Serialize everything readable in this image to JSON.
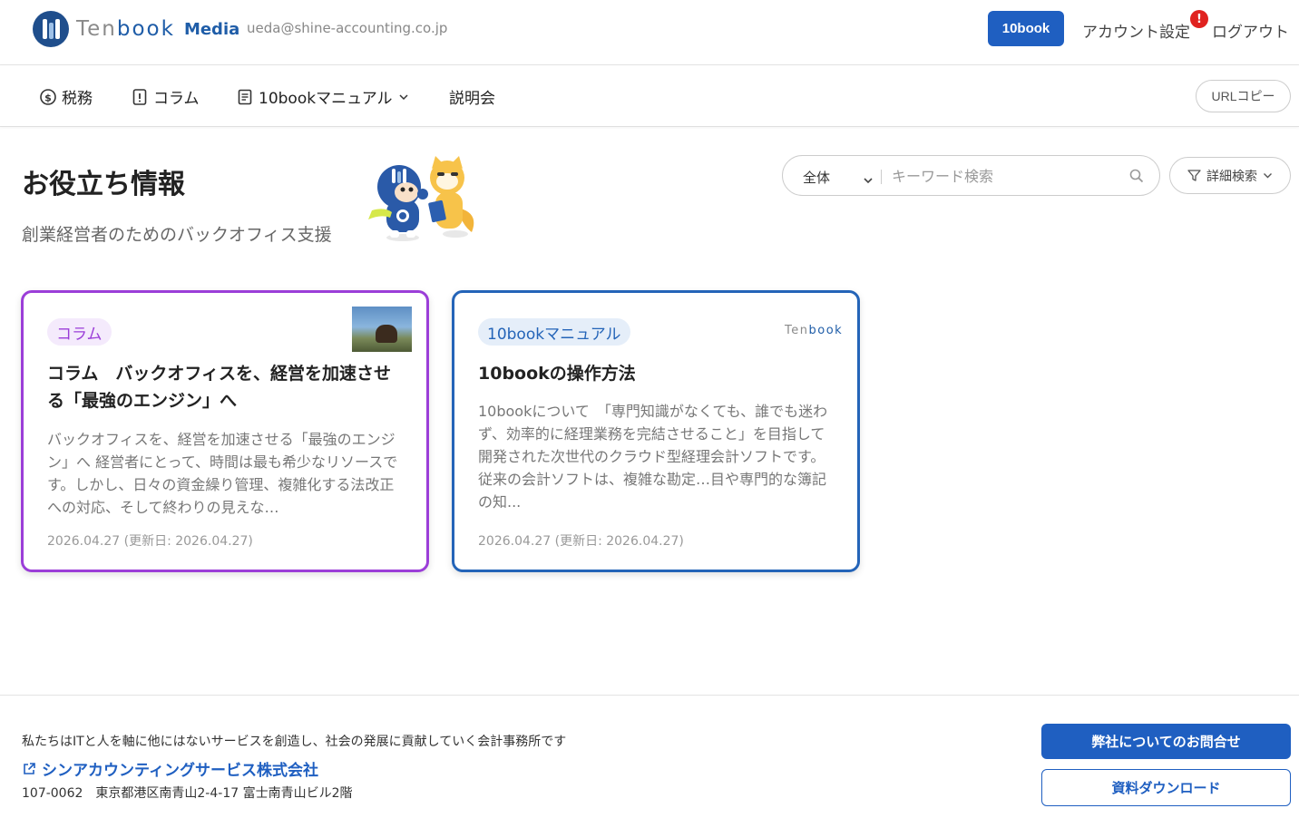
{
  "header": {
    "logo_ten": "Ten",
    "logo_book": "book",
    "logo_media": "Media",
    "user_email": "ueda@shine-accounting.co.jp",
    "btn_10book": "10book",
    "account_settings": "アカウント設定",
    "alert_badge": "!",
    "logout": "ログアウト"
  },
  "nav": {
    "items": [
      {
        "label": "税務",
        "icon": "dollar-circle-icon"
      },
      {
        "label": "コラム",
        "icon": "exclamation-doc-icon"
      },
      {
        "label": "10bookマニュアル",
        "icon": "document-list-icon",
        "has_dropdown": true
      },
      {
        "label": "説明会"
      }
    ],
    "url_copy": "URLコピー"
  },
  "hero": {
    "title": "お役立ち情報",
    "subtitle": "創業経営者のためのバックオフィス支援"
  },
  "search": {
    "scope": "全体",
    "placeholder": "キーワード検索",
    "advanced": "詳細検索"
  },
  "cards": [
    {
      "tag": "コラム",
      "title": "コラム　バックオフィスを、経営を加速させる「最強のエンジン」へ",
      "excerpt": "バックオフィスを、経営を加速させる「最強のエンジン」へ 経営者にとって、時間は最も希少なリソースです。しかし、日々の資金繰り管理、複雑化する法改正への対応、そして終わりの見えな…",
      "date": "2026.04.27 (更新日: 2026.04.27)",
      "accent": "#9b3ed8"
    },
    {
      "tag": "10bookマニュアル",
      "brand_ten": "Ten",
      "brand_book": "book",
      "title": "10bookの操作方法",
      "excerpt": "10bookについて　「専門知識がなくても、誰でも迷わず、効率的に経理業務を完結させること」を目指して開発された次世代のクラウド型経理会計ソフトです。 従来の会計ソフトは、複雑な勘定…目や専門的な簿記の知...",
      "date": "2026.04.27 (更新日: 2026.04.27)",
      "accent": "#2464b8"
    }
  ],
  "footer": {
    "tagline": "私たちはITと人を軸に他にはないサービスを創造し、社会の発展に貢献していく会計事務所です",
    "company": "シンアカウンティングサービス株式会社",
    "address": "107-0062　東京都港区南青山2-4-17 富士南青山ビル2階",
    "contact": "弊社についてのお問合せ",
    "download": "資料ダウンロード"
  },
  "colors": {
    "primary": "#1f5fc1",
    "purple": "#9b3ed8",
    "alert": "#e0221f"
  }
}
